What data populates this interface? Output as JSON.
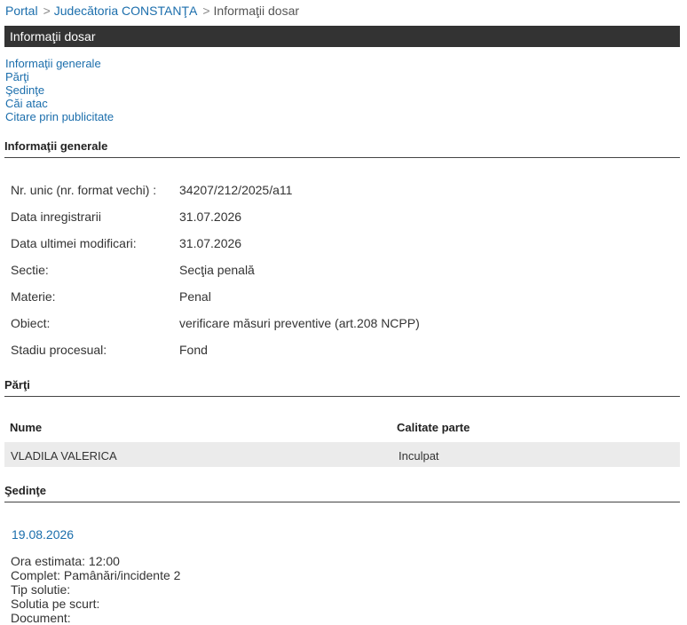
{
  "breadcrumb": {
    "portal": "Portal",
    "court": "Judecătoria CONSTANŢA",
    "current": "Informaţii dosar",
    "separator": ">"
  },
  "page": {
    "title": "Informaţii dosar"
  },
  "toc": {
    "items": [
      "Informaţii generale",
      "Părţi",
      "Şedinţe",
      "Căi atac",
      "Citare prin publicitate"
    ]
  },
  "general": {
    "heading": "Informaţii generale",
    "rows": [
      {
        "label": "Nr. unic (nr. format vechi) :",
        "value": "34207/212/2025/a11"
      },
      {
        "label": "Data inregistrarii",
        "value": "31.07.2026"
      },
      {
        "label": "Data ultimei modificari:",
        "value": "31.07.2026"
      },
      {
        "label": "Sectie:",
        "value": "Secţia penală"
      },
      {
        "label": "Materie:",
        "value": "Penal"
      },
      {
        "label": "Obiect:",
        "value": "verificare măsuri preventive (art.208 NCPP)"
      },
      {
        "label": "Stadiu procesual:",
        "value": "Fond"
      }
    ]
  },
  "parti": {
    "heading": "Părţi",
    "columns": [
      "Nume",
      "Calitate parte"
    ],
    "rows": [
      {
        "name": "VLADILA VALERICA",
        "role": "Inculpat"
      }
    ]
  },
  "sedinte": {
    "heading": "Şedinţe",
    "date": "19.08.2026",
    "details": [
      "Ora estimata: 12:00",
      "Complet: Pamânări/incidente 2",
      "Tip solutie:",
      "Solutia pe scurt:",
      "Document:"
    ]
  }
}
